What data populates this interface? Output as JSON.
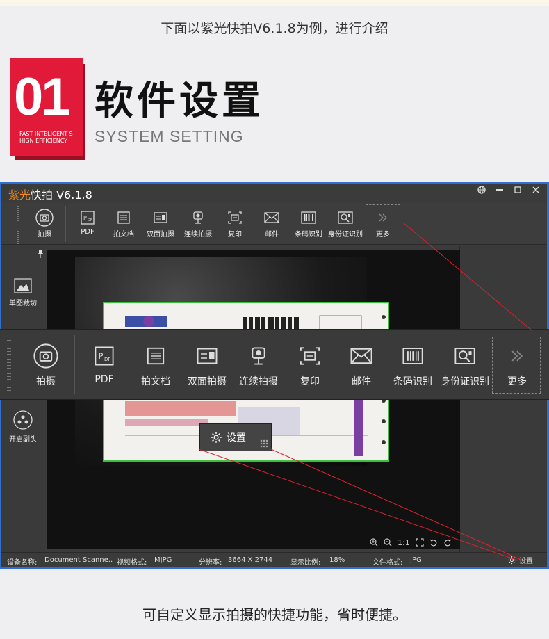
{
  "intro_text": "下面以紫光快拍V6.1.8为例，进行介绍",
  "section": {
    "number": "01",
    "badge_sub": "FAST INTELIGENT S\nHIGN EFFICIENCY",
    "title": "软件设置",
    "subtitle": "SYSTEM SETTING"
  },
  "app": {
    "title_brand": "紫光",
    "title_rest": "快拍 V6.1.8",
    "toolbar": [
      {
        "label": "拍摄",
        "icon": "camera-icon"
      },
      {
        "label": "PDF",
        "icon": "pdf-icon"
      },
      {
        "label": "拍文档",
        "icon": "document-icon"
      },
      {
        "label": "双面拍摄",
        "icon": "id-card-icon"
      },
      {
        "label": "连续拍摄",
        "icon": "continuous-shoot-icon"
      },
      {
        "label": "复印",
        "icon": "copy-icon"
      },
      {
        "label": "邮件",
        "icon": "mail-icon"
      },
      {
        "label": "条码识别",
        "icon": "barcode-icon"
      },
      {
        "label": "身份证识别",
        "icon": "id-scan-icon"
      },
      {
        "label": "更多",
        "icon": "chevron-double-right-icon"
      }
    ],
    "left_panel": [
      {
        "label": "单图裁切",
        "icon": "crop-image-icon"
      },
      {
        "label": "开启副头",
        "icon": "secondary-camera-icon"
      }
    ],
    "zoom_controls": [
      "1:1"
    ],
    "status": {
      "device_label": "设备名称:",
      "device_value": "Document Scanne..",
      "format_label": "视频格式:",
      "format_value": "MJPG",
      "resolution_label": "分辨率:",
      "resolution_value": "3664 X 2744",
      "ratio_label": "显示比例:",
      "ratio_value": "18%",
      "filetype_label": "文件格式:",
      "filetype_value": "JPG",
      "settings_label": "设置"
    },
    "settings_popup_label": "设置"
  },
  "caption": "可自定义显示拍摄的快捷功能，省时便捷。",
  "colors": {
    "accent_red": "#e01a38",
    "app_bg": "#3b3b3b",
    "brand_orange": "#f08a25",
    "window_border": "#2f6fd0"
  }
}
